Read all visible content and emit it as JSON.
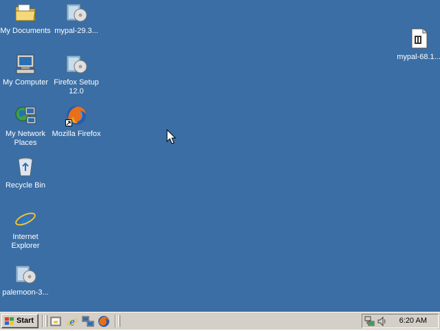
{
  "desktop": {
    "background": "#3a6ea5",
    "icons": [
      {
        "name": "my-documents-icon",
        "label": "My Documents"
      },
      {
        "name": "mypal-29-installer-icon",
        "label": "mypal-29.3..."
      },
      {
        "name": "my-computer-icon",
        "label": "My Computer"
      },
      {
        "name": "firefox-setup-installer-icon",
        "label": "Firefox Setup 12.0"
      },
      {
        "name": "my-network-places-icon",
        "label": "My Network Places"
      },
      {
        "name": "mozilla-firefox-icon",
        "label": "Mozilla Firefox"
      },
      {
        "name": "recycle-bin-icon",
        "label": "Recycle Bin"
      },
      {
        "name": "internet-explorer-icon",
        "label": "Internet Explorer"
      },
      {
        "name": "palemoon-installer-icon",
        "label": "palemoon-3..."
      },
      {
        "name": "mypal-68-archive-icon",
        "label": "mypal-68.1..."
      }
    ]
  },
  "taskbar": {
    "start_label": "Start",
    "quick_launch": [
      {
        "name": "show-desktop-icon"
      },
      {
        "name": "internet-explorer-icon"
      },
      {
        "name": "network-icon"
      },
      {
        "name": "firefox-icon"
      }
    ],
    "tray": {
      "icons": [
        "network-connection-icon",
        "volume-icon"
      ],
      "clock": "6:20 AM"
    }
  }
}
